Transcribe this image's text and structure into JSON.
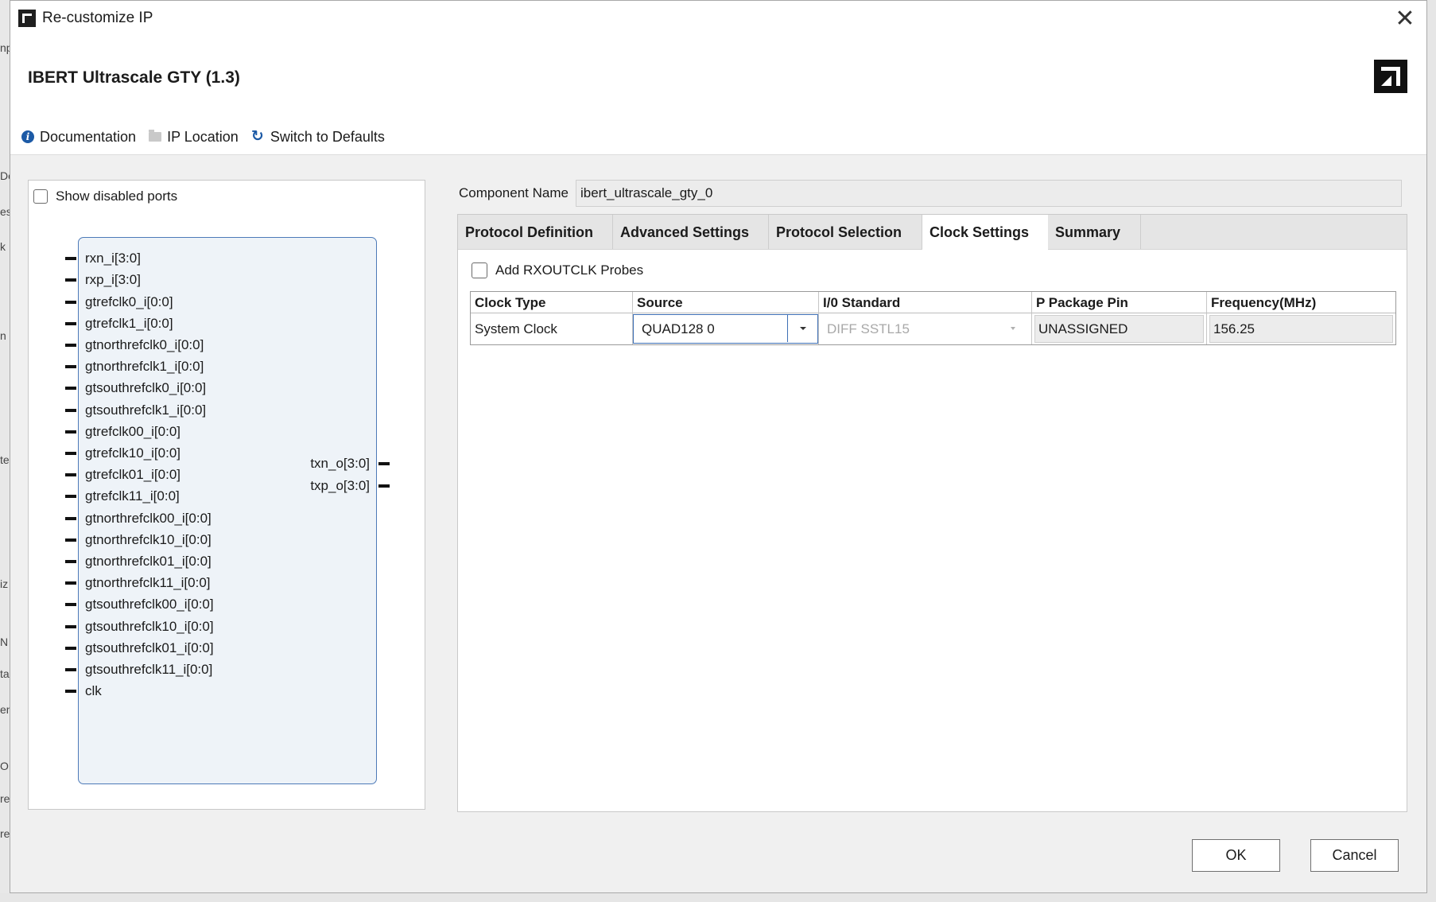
{
  "window": {
    "title": "Re-customize IP",
    "close_glyph": "✕"
  },
  "background_fragments": [
    "np",
    "De",
    "es",
    "k",
    "n",
    "te",
    "iz",
    "N",
    "ta",
    "en",
    "OE",
    "re",
    "re"
  ],
  "header": {
    "ip_title": "IBERT Ultrascale GTY (1.3)",
    "logo_icon": "amd-logo-icon"
  },
  "toolbar": {
    "documentation": "Documentation",
    "ip_location": "IP Location",
    "switch_defaults": "Switch to Defaults"
  },
  "left_panel": {
    "show_disabled_ports": "Show disabled ports",
    "input_ports": [
      "rxn_i[3:0]",
      "rxp_i[3:0]",
      "gtrefclk0_i[0:0]",
      "gtrefclk1_i[0:0]",
      "gtnorthrefclk0_i[0:0]",
      "gtnorthrefclk1_i[0:0]",
      "gtsouthrefclk0_i[0:0]",
      "gtsouthrefclk1_i[0:0]",
      "gtrefclk00_i[0:0]",
      "gtrefclk10_i[0:0]",
      "gtrefclk01_i[0:0]",
      "gtrefclk11_i[0:0]",
      "gtnorthrefclk00_i[0:0]",
      "gtnorthrefclk10_i[0:0]",
      "gtnorthrefclk01_i[0:0]",
      "gtnorthrefclk11_i[0:0]",
      "gtsouthrefclk00_i[0:0]",
      "gtsouthrefclk10_i[0:0]",
      "gtsouthrefclk01_i[0:0]",
      "gtsouthrefclk11_i[0:0]",
      "clk"
    ],
    "output_ports": [
      "txn_o[3:0]",
      "txp_o[3:0]"
    ]
  },
  "component": {
    "label": "Component Name",
    "value": "ibert_ultrascale_gty_0"
  },
  "tabs": [
    "Protocol Definition",
    "Advanced Settings",
    "Protocol Selection",
    "Clock Settings",
    "Summary"
  ],
  "active_tab": "Clock Settings",
  "clock_settings": {
    "add_probes_label": "Add RXOUTCLK Probes",
    "table": {
      "headers": [
        "Clock Type",
        "Source",
        "I/0 Standard",
        "P Package Pin",
        "Frequency(MHz)"
      ],
      "row": {
        "clock_type": "System Clock",
        "source": "QUAD128 0",
        "io_standard": "DIFF SSTL15",
        "package_pin": "UNASSIGNED",
        "frequency": "156.25"
      }
    }
  },
  "buttons": {
    "ok": "OK",
    "cancel": "Cancel"
  }
}
